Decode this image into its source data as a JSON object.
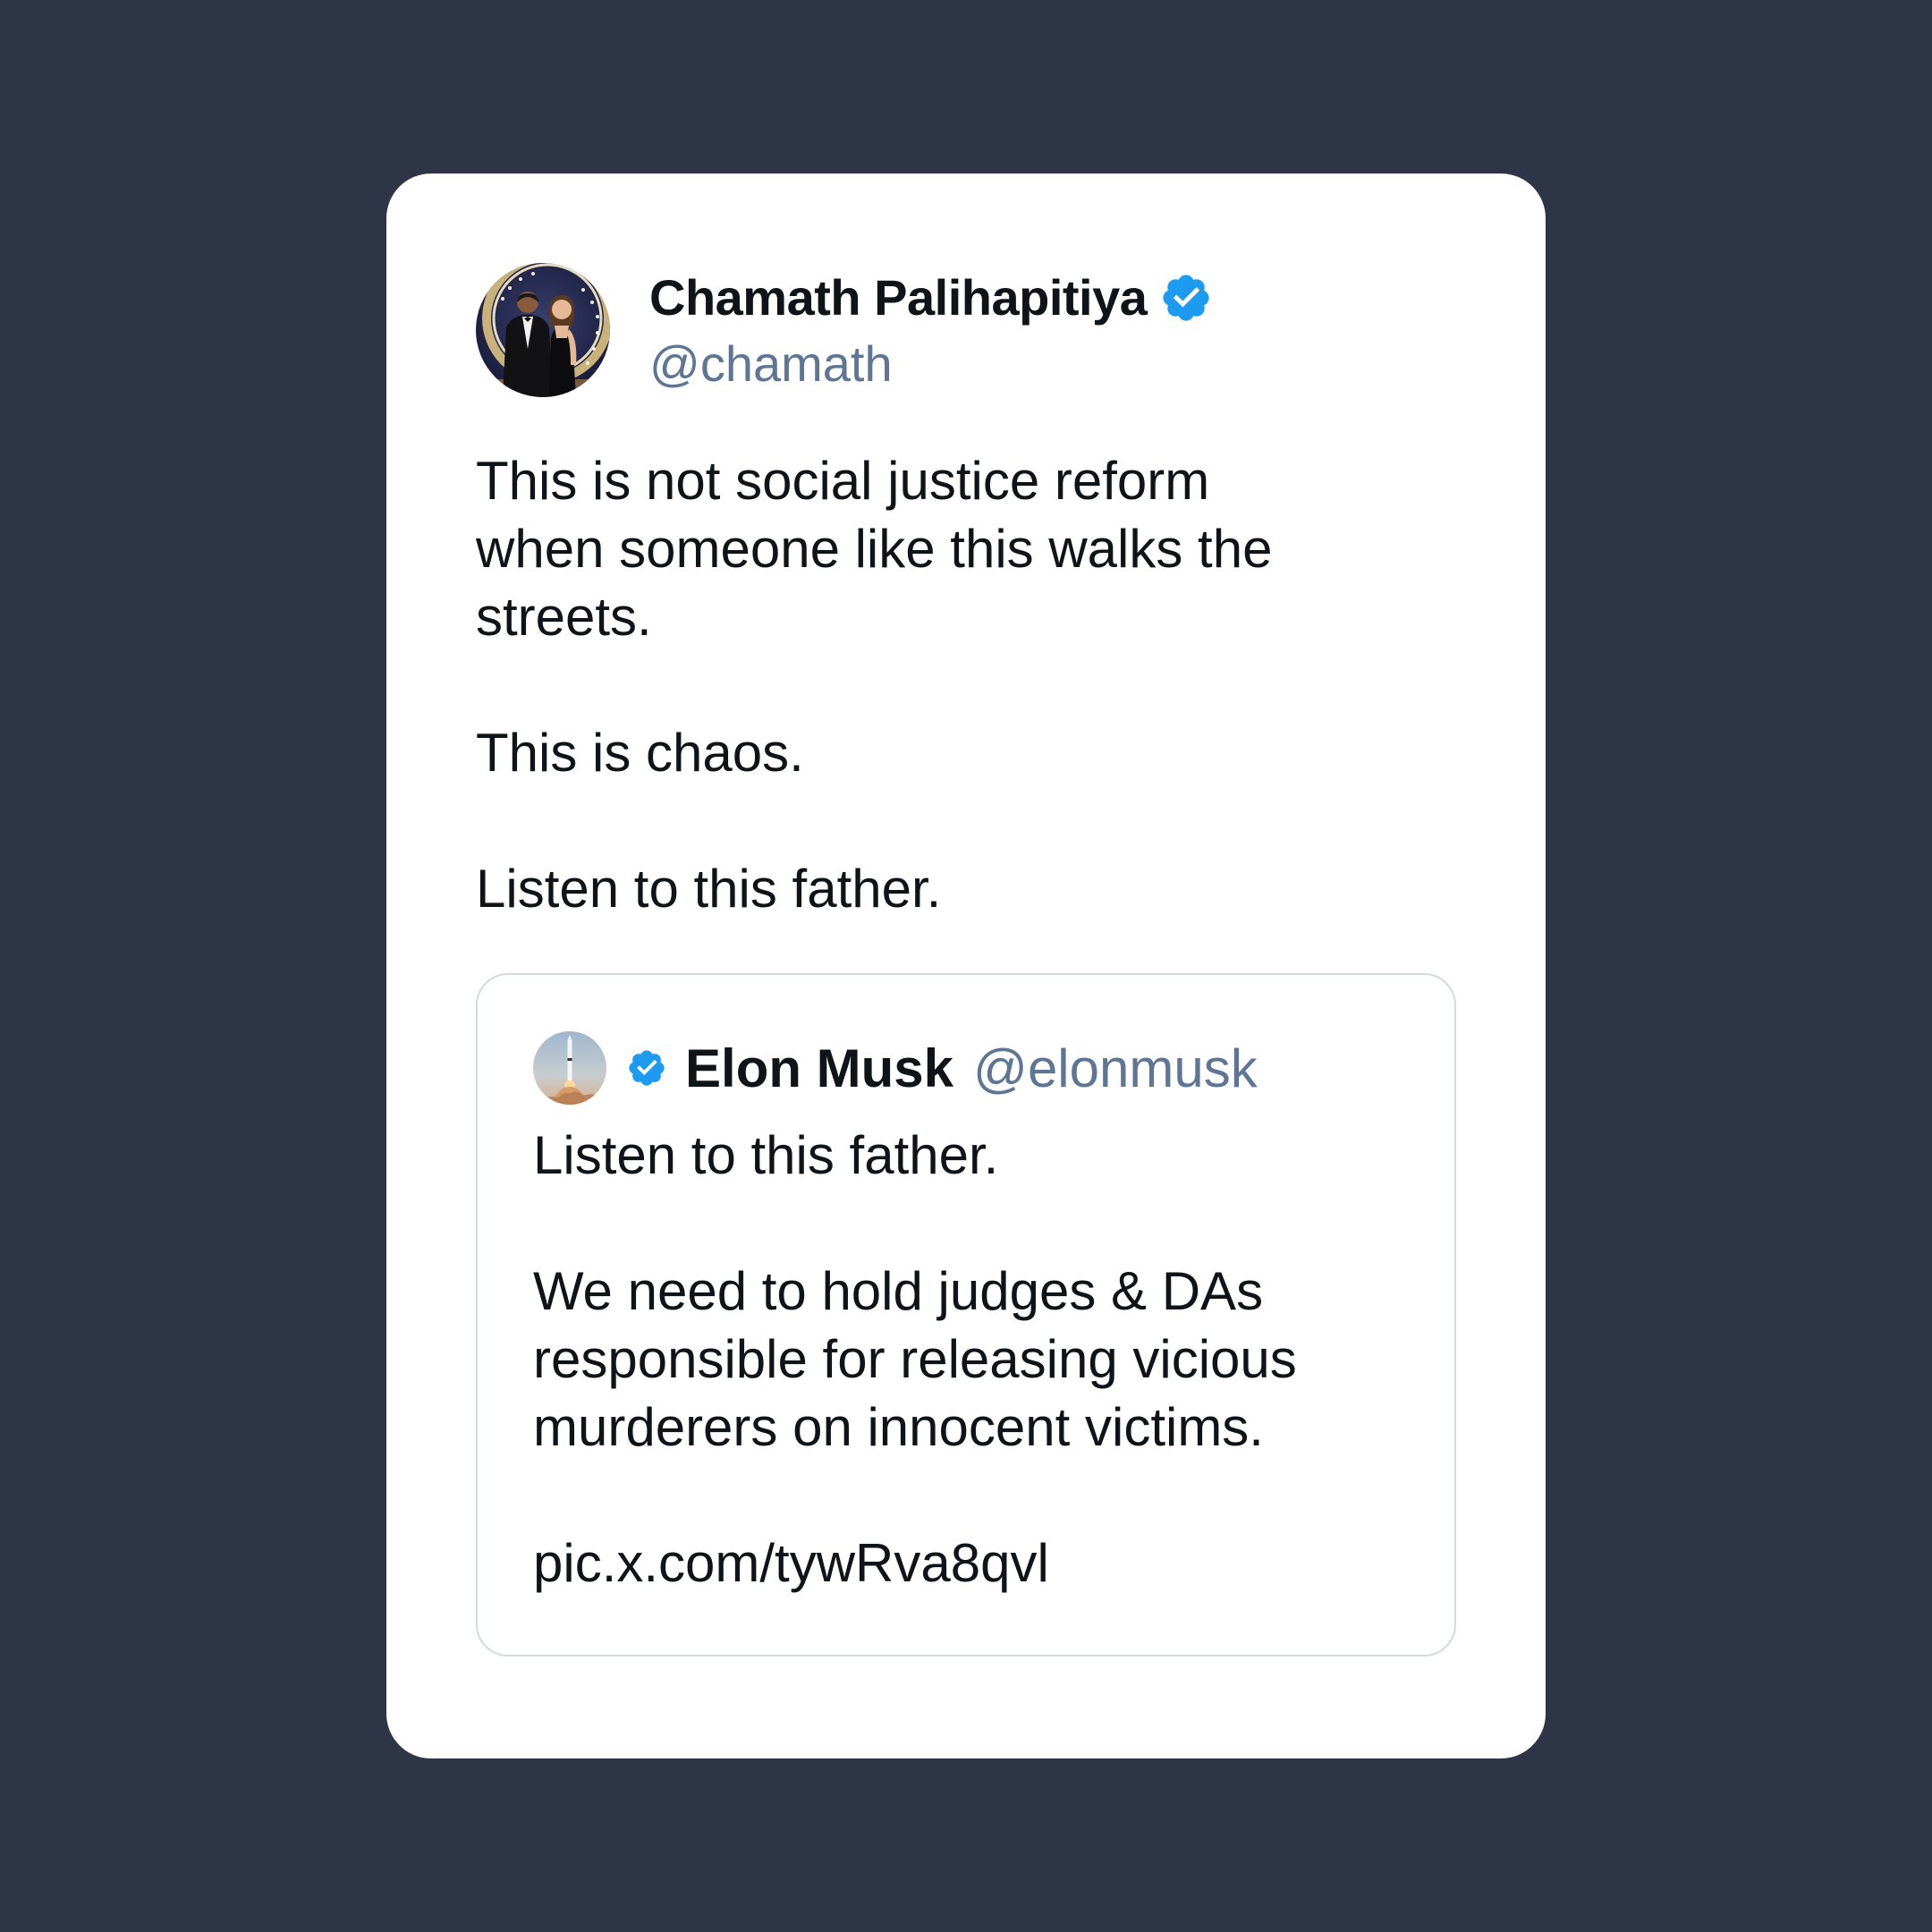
{
  "background_color": "#2e3547",
  "accent_verified_color": "#1d9bf0",
  "tweet": {
    "author": {
      "name": "Chamath Palihapitiya",
      "handle": "@chamath",
      "avatar_icon": "profile-photo-couple",
      "verified_icon": "verified-badge-icon"
    },
    "text": "This is not social justice reform\nwhen someone like this walks the\nstreets.\n\nThis is chaos.\n\nListen to this father.",
    "quoted": {
      "author": {
        "name": "Elon Musk",
        "handle": "@elonmusk",
        "avatar_icon": "rocket-launch-photo",
        "verified_icon": "verified-badge-icon"
      },
      "text": "Listen to this father.\n\nWe need to hold judges & DAs\nresponsible for releasing vicious\nmurderers on innocent victims.\n\n pic.x.com/tywRva8qvl"
    }
  }
}
